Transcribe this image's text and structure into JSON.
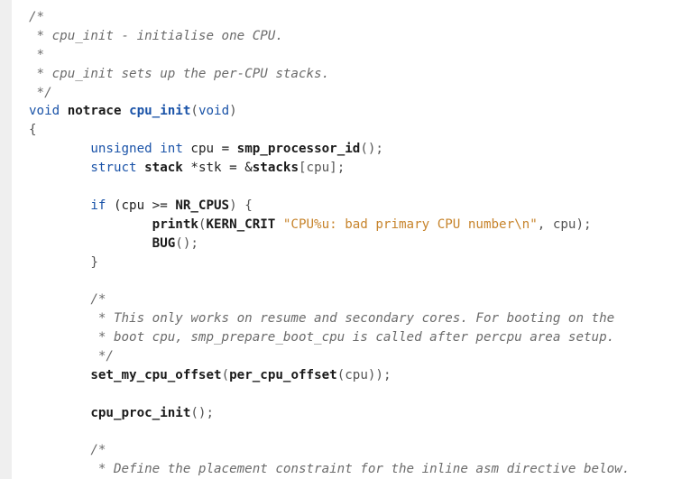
{
  "code_lines": [
    {
      "segments": [
        {
          "t": "/*",
          "c": "comment"
        }
      ]
    },
    {
      "segments": [
        {
          "t": " * cpu_init - initialise one CPU.",
          "c": "comment"
        }
      ]
    },
    {
      "segments": [
        {
          "t": " *",
          "c": "comment"
        }
      ]
    },
    {
      "segments": [
        {
          "t": " * cpu_init sets up the per-CPU stacks.",
          "c": "comment"
        }
      ]
    },
    {
      "segments": [
        {
          "t": " */",
          "c": "comment"
        }
      ]
    },
    {
      "segments": [
        {
          "t": "void",
          "c": "kw"
        },
        {
          "t": " ",
          "c": ""
        },
        {
          "t": "notrace",
          "c": "func"
        },
        {
          "t": " ",
          "c": ""
        },
        {
          "t": "cpu_init",
          "c": "funcdef"
        },
        {
          "t": "(",
          "c": "punct"
        },
        {
          "t": "void",
          "c": "kw"
        },
        {
          "t": ")",
          "c": "punct"
        }
      ]
    },
    {
      "segments": [
        {
          "t": "{",
          "c": "punct"
        }
      ]
    },
    {
      "segments": [
        {
          "t": "        ",
          "c": ""
        },
        {
          "t": "unsigned",
          "c": "kw"
        },
        {
          "t": " ",
          "c": ""
        },
        {
          "t": "int",
          "c": "kw"
        },
        {
          "t": " cpu = ",
          "c": ""
        },
        {
          "t": "smp_processor_id",
          "c": "func"
        },
        {
          "t": "();",
          "c": "punct"
        }
      ]
    },
    {
      "segments": [
        {
          "t": "        ",
          "c": ""
        },
        {
          "t": "struct",
          "c": "kw"
        },
        {
          "t": " ",
          "c": ""
        },
        {
          "t": "stack",
          "c": "func"
        },
        {
          "t": " *stk = &",
          "c": ""
        },
        {
          "t": "stacks",
          "c": "func"
        },
        {
          "t": "[cpu];",
          "c": "punct"
        }
      ]
    },
    {
      "segments": [
        {
          "t": "",
          "c": ""
        }
      ]
    },
    {
      "segments": [
        {
          "t": "        ",
          "c": ""
        },
        {
          "t": "if",
          "c": "kw"
        },
        {
          "t": " (cpu >= ",
          "c": ""
        },
        {
          "t": "NR_CPUS",
          "c": "func"
        },
        {
          "t": ") {",
          "c": "punct"
        }
      ]
    },
    {
      "segments": [
        {
          "t": "                ",
          "c": ""
        },
        {
          "t": "printk",
          "c": "func"
        },
        {
          "t": "(",
          "c": "punct"
        },
        {
          "t": "KERN_CRIT",
          "c": "func"
        },
        {
          "t": " ",
          "c": ""
        },
        {
          "t": "\"CPU%u: bad primary CPU number\\n\"",
          "c": "str"
        },
        {
          "t": ", cpu);",
          "c": "punct"
        }
      ]
    },
    {
      "segments": [
        {
          "t": "                ",
          "c": ""
        },
        {
          "t": "BUG",
          "c": "func"
        },
        {
          "t": "();",
          "c": "punct"
        }
      ]
    },
    {
      "segments": [
        {
          "t": "        }",
          "c": "punct"
        }
      ]
    },
    {
      "segments": [
        {
          "t": "",
          "c": ""
        }
      ]
    },
    {
      "segments": [
        {
          "t": "        /*",
          "c": "comment"
        }
      ]
    },
    {
      "segments": [
        {
          "t": "         * This only works on resume and secondary cores. For booting on the",
          "c": "comment"
        }
      ]
    },
    {
      "segments": [
        {
          "t": "         * boot cpu, smp_prepare_boot_cpu is called after percpu area setup.",
          "c": "comment"
        }
      ]
    },
    {
      "segments": [
        {
          "t": "         */",
          "c": "comment"
        }
      ]
    },
    {
      "segments": [
        {
          "t": "        ",
          "c": ""
        },
        {
          "t": "set_my_cpu_offset",
          "c": "func"
        },
        {
          "t": "(",
          "c": "punct"
        },
        {
          "t": "per_cpu_offset",
          "c": "func"
        },
        {
          "t": "(cpu));",
          "c": "punct"
        }
      ]
    },
    {
      "segments": [
        {
          "t": "",
          "c": ""
        }
      ]
    },
    {
      "segments": [
        {
          "t": "        ",
          "c": ""
        },
        {
          "t": "cpu_proc_init",
          "c": "func"
        },
        {
          "t": "();",
          "c": "punct"
        }
      ]
    },
    {
      "segments": [
        {
          "t": "",
          "c": ""
        }
      ]
    },
    {
      "segments": [
        {
          "t": "        /*",
          "c": "comment"
        }
      ]
    },
    {
      "segments": [
        {
          "t": "         * Define the placement constraint for the inline asm directive below.",
          "c": "comment"
        }
      ]
    }
  ]
}
